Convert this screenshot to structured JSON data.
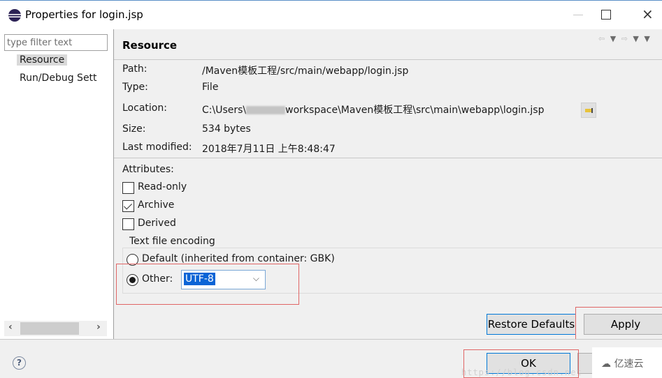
{
  "window": {
    "title": "Properties for login.jsp",
    "minimize_label": "—",
    "close_label": "×"
  },
  "sidebar": {
    "filter_placeholder": "type filter text",
    "items": [
      {
        "label": "Resource",
        "selected": true
      },
      {
        "label": "Run/Debug Sett",
        "selected": false
      }
    ],
    "scroll_left": "‹",
    "scroll_right": "›"
  },
  "page": {
    "title": "Resource",
    "nav": {
      "back": "⇦",
      "back_menu": "▼",
      "forward": "⇨",
      "forward_menu": "▼",
      "menu": "▼"
    },
    "properties": [
      {
        "label": "Path:",
        "value": "/Maven模板工程/src/main/webapp/login.jsp"
      },
      {
        "label": "Type:",
        "value": "File"
      },
      {
        "label": "Location:",
        "value_prefix": "C:\\Users\\",
        "value_suffix": "workspace\\Maven模板工程\\src\\main\\webapp\\login.jsp"
      },
      {
        "label": "Size:",
        "value": "534  bytes"
      },
      {
        "label": "Last modified:",
        "value": "2018年7月11日 上午8:48:47"
      }
    ],
    "attributes_label": "Attributes:",
    "attributes": [
      {
        "label": "Read-only",
        "checked": false
      },
      {
        "label": "Archive",
        "checked": true
      },
      {
        "label": "Derived",
        "checked": false
      }
    ],
    "encoding": {
      "group_label": "Text file encoding",
      "default_label": "Default (inherited from container: GBK)",
      "other_label": "Other:",
      "selected": "other",
      "other_value": "UTF-8",
      "combo_arrow": "⌵"
    },
    "restore_defaults_label": "Restore Defaults",
    "apply_label": "Apply"
  },
  "footer": {
    "help_label": "?",
    "ok_label": "OK",
    "watermark": "亿速云",
    "url_watermark": "https://blog.csdn.net"
  },
  "colors": {
    "highlight_border": "#e06666",
    "selection": "#0a64d6",
    "focus_border": "#0078d7"
  }
}
